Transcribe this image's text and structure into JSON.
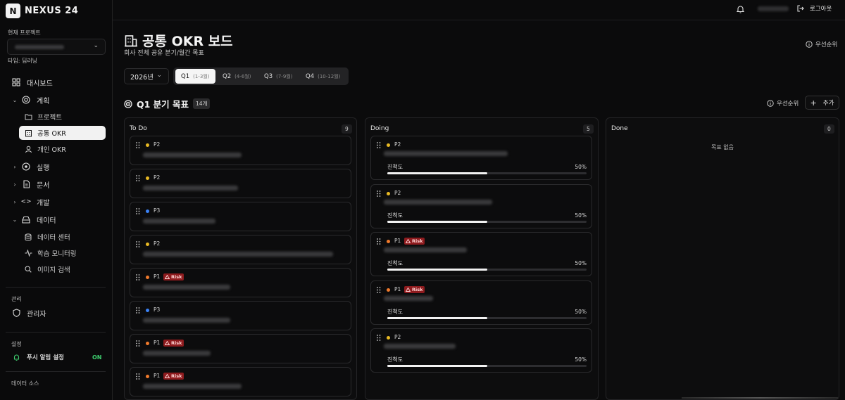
{
  "brand": {
    "logo_letter": "N",
    "name": "NEXUS 24"
  },
  "sidebar": {
    "current_project_label": "현재 프로젝트",
    "project_type": "타입: 딥러닝",
    "dashboard": "대시보드",
    "plan": "계획",
    "plan_items": [
      "프로젝트",
      "공통 OKR",
      "개인 OKR"
    ],
    "execute": "실행",
    "docs": "문서",
    "dev": "개발",
    "data": "데이터",
    "data_items": [
      "데이터 센터",
      "학습 모니터링",
      "이미지 검색"
    ],
    "admin_section": "관리",
    "admin": "관리자",
    "settings_section": "설정",
    "push_setting": "푸시 알림 설정",
    "push_state": "ON",
    "data_source_section": "데이터 소스"
  },
  "topbar": {
    "logout": "로그아웃"
  },
  "header": {
    "title": "공통 OKR 보드",
    "subtitle": "회사 전체 공유 분기/월간 목표",
    "priority": "우선순위"
  },
  "controls": {
    "year": "2026년",
    "quarters": [
      {
        "label": "Q1",
        "range": "(1-3월)"
      },
      {
        "label": "Q2",
        "range": "(4-6월)"
      },
      {
        "label": "Q3",
        "range": "(7-9월)"
      },
      {
        "label": "Q4",
        "range": "(10-12월)"
      }
    ],
    "active_quarter": "Q1"
  },
  "section": {
    "title": "Q1 분기 목표",
    "count": "14개",
    "priority": "우선순위",
    "add": "추가"
  },
  "columns": [
    {
      "name": "To Do",
      "count": "9",
      "cards": [
        {
          "priority": "P2",
          "risk": false
        },
        {
          "priority": "P2",
          "risk": false
        },
        {
          "priority": "P3",
          "risk": false
        },
        {
          "priority": "P2",
          "risk": false
        },
        {
          "priority": "P1",
          "risk": true
        },
        {
          "priority": "P3",
          "risk": false
        },
        {
          "priority": "P1",
          "risk": true
        },
        {
          "priority": "P1",
          "risk": true
        }
      ]
    },
    {
      "name": "Doing",
      "count": "5",
      "cards": [
        {
          "priority": "P2",
          "risk": false,
          "progress_label": "진척도",
          "progress": "50%"
        },
        {
          "priority": "P2",
          "risk": false,
          "progress_label": "진척도",
          "progress": "50%"
        },
        {
          "priority": "P1",
          "risk": true,
          "progress_label": "진척도",
          "progress": "50%"
        },
        {
          "priority": "P1",
          "risk": true,
          "progress_label": "진척도",
          "progress": "50%"
        },
        {
          "priority": "P2",
          "risk": false,
          "progress_label": "진척도",
          "progress": "50%"
        }
      ]
    },
    {
      "name": "Done",
      "count": "0",
      "empty_text": "목표 없음",
      "cards": []
    }
  ],
  "risk_label": "Risk",
  "colors": {
    "p1": "#f07a2c",
    "p2": "#e8b923",
    "p3": "#3b82f6",
    "risk_bg": "#8e1b1e",
    "on": "#3ecf6f"
  }
}
